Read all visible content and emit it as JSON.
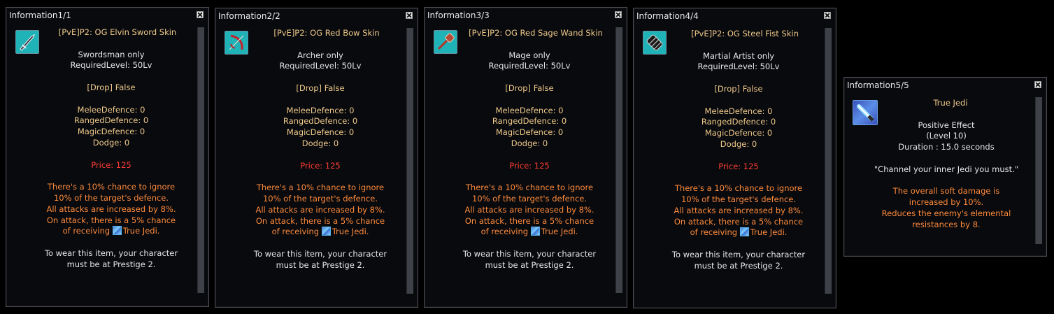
{
  "windows": [
    {
      "title": "Information1/1",
      "item_name": "[PvE]P2: OG Elvin Sword Skin",
      "icon": "sword-skin-icon",
      "class_req": "Swordsman only",
      "level_req": "RequiredLevel: 50Lv",
      "drop": "[Drop] False",
      "melee": "MeleeDefence: 0",
      "ranged": "RangedDefence: 0",
      "magic": "MagicDefence: 0",
      "dodge": "Dodge: 0",
      "price": "Price: 125",
      "effect1": "There's a 10% chance to ignore",
      "effect2": "10% of the target's defence.",
      "effect3": "All attacks are increased by 8%.",
      "effect4": "On attack, there is a 5% chance",
      "effect5_prefix": "of receiving",
      "effect5_link": "True Jedi.",
      "wear1": "To wear this item, your character",
      "wear2": "must be at Prestige 2."
    },
    {
      "title": "Information2/2",
      "item_name": "[PvE]P2: OG Red Bow Skin",
      "icon": "bow-skin-icon",
      "class_req": "Archer only",
      "level_req": "RequiredLevel: 50Lv",
      "drop": "[Drop] False",
      "melee": "MeleeDefence: 0",
      "ranged": "RangedDefence: 0",
      "magic": "MagicDefence: 0",
      "dodge": "Dodge: 0",
      "price": "Price: 125",
      "effect1": "There's a 10% chance to ignore",
      "effect2": "10% of the target's defence.",
      "effect3": "All attacks are increased by 8%.",
      "effect4": "On attack, there is a 5% chance",
      "effect5_prefix": "of receiving",
      "effect5_link": "True Jedi.",
      "wear1": "To wear this item, your character",
      "wear2": "must be at Prestige 2."
    },
    {
      "title": "Information3/3",
      "item_name": "[PvE]P2: OG Red Sage Wand Skin",
      "icon": "wand-skin-icon",
      "class_req": "Mage only",
      "level_req": "RequiredLevel: 50Lv",
      "drop": "[Drop] False",
      "melee": "MeleeDefence: 0",
      "ranged": "RangedDefence: 0",
      "magic": "MagicDefence: 0",
      "dodge": "Dodge: 0",
      "price": "Price: 125",
      "effect1": "There's a 10% chance to ignore",
      "effect2": "10% of the target's defence.",
      "effect3": "All attacks are increased by 8%.",
      "effect4": "On attack, there is a 5% chance",
      "effect5_prefix": "of receiving",
      "effect5_link": "True Jedi.",
      "wear1": "To wear this item, your character",
      "wear2": "must be at Prestige 2."
    },
    {
      "title": "Information4/4",
      "item_name": "[PvE]P2: OG Steel Fist Skin",
      "icon": "fist-skin-icon",
      "class_req": "Martial Artist only",
      "level_req": "RequiredLevel: 50Lv",
      "drop": "[Drop] False",
      "melee": "MeleeDefence: 0",
      "ranged": "RangedDefence: 0",
      "magic": "MagicDefence: 0",
      "dodge": "Dodge: 0",
      "price": "Price: 125",
      "effect1": "There's a 10% chance to ignore",
      "effect2": "10% of the target's defence.",
      "effect3": "All attacks are increased by 8%.",
      "effect4": "On attack, there is a 5% chance",
      "effect5_prefix": "of receiving",
      "effect5_link": "True Jedi.",
      "wear1": "To wear this item, your character",
      "wear2": "must be at Prestige 2."
    }
  ],
  "buff_window": {
    "title": "Information5/5",
    "icon": "true-jedi-buff-icon",
    "name": "True Jedi",
    "type": "Positive Effect",
    "level": "(Level 10)",
    "duration": "Duration : 15.0 seconds",
    "quote": "\"Channel your inner Jedi you must.\"",
    "effect1": "The overall soft damage is",
    "effect2": "increased by 10%.",
    "effect3": "Reduces the enemy's elemental",
    "effect4": "resistances by 8."
  },
  "colors": {
    "gold": "#f0c98a",
    "price_red": "#ff3c32",
    "effect_orange": "#ff8a3a",
    "text_white": "#e6e6e6",
    "icon_teal": "#1fb3b8"
  }
}
